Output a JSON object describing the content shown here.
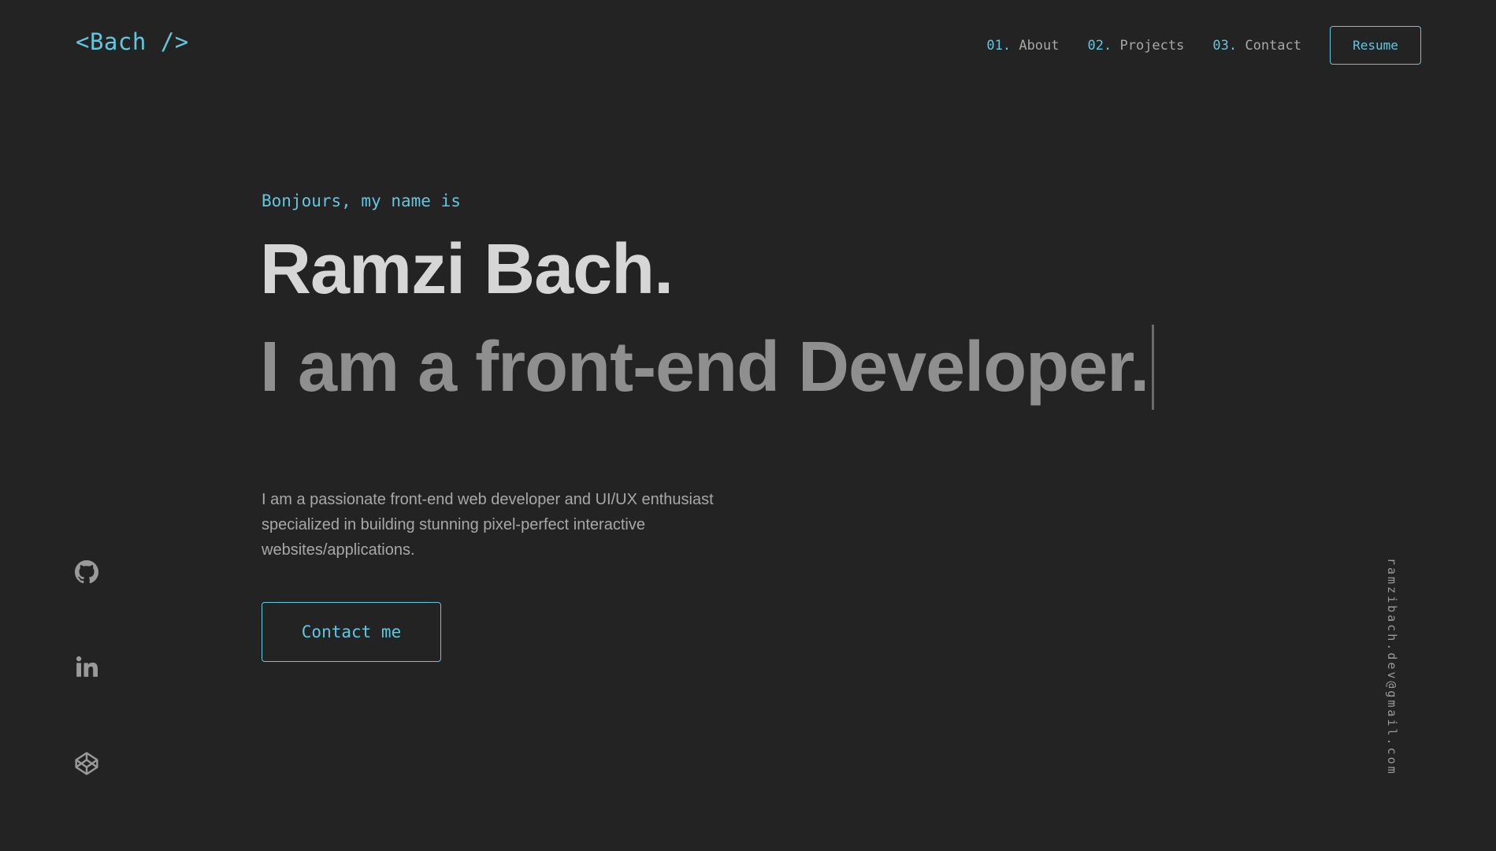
{
  "header": {
    "logo": "<Bach />",
    "nav": [
      {
        "number": "01.",
        "label": "About"
      },
      {
        "number": "02.",
        "label": "Projects"
      },
      {
        "number": "03.",
        "label": "Contact"
      }
    ],
    "resume_label": "Resume"
  },
  "hero": {
    "greeting": "Bonjours, my name is",
    "name": "Ramzi Bach.",
    "tagline": "I am a front-end Developer.",
    "intro": "I am a passionate front-end web developer and UI/UX enthusiast specialized in building stunning pixel-perfect interactive websites/applications.",
    "cta_label": "Contact me"
  },
  "social": {
    "icons": [
      "github-icon",
      "linkedin-icon",
      "codepen-icon"
    ]
  },
  "email": "ramzibach.dev@gmail.com",
  "colors": {
    "background": "#232323",
    "accent": "#62c6df",
    "heading": "#d6d6d6",
    "subheading": "#8f8f8f",
    "text": "#a8a8a8"
  }
}
